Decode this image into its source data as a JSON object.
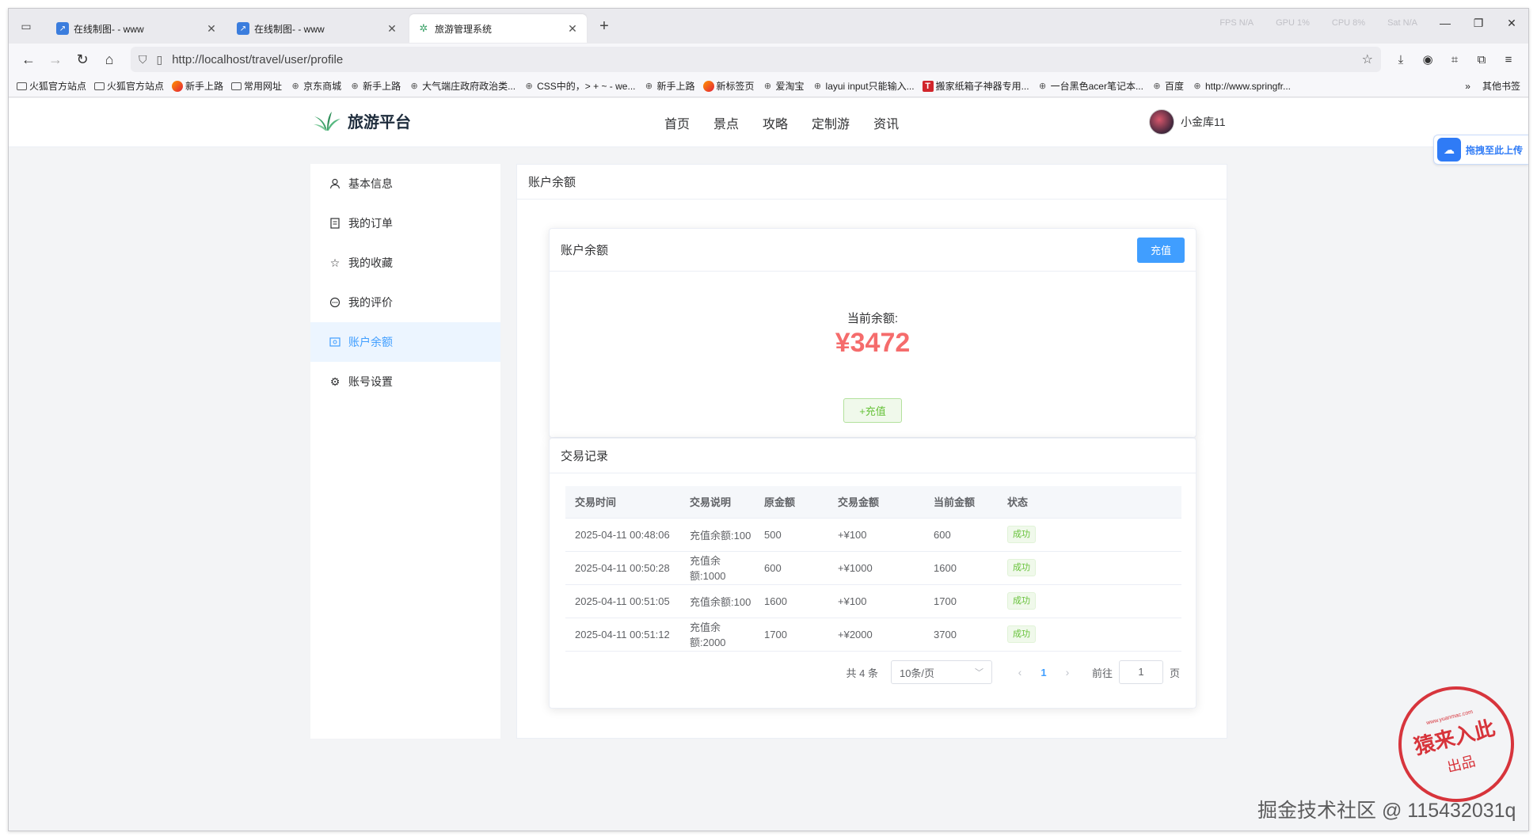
{
  "browser": {
    "tabs": [
      {
        "title": "在线制图- - www",
        "icon": "chart-favicon"
      },
      {
        "title": "在线制图- - www",
        "icon": "chart-favicon"
      },
      {
        "title": "旅游管理系统",
        "icon": "leaf-favicon"
      }
    ],
    "window_stats": [
      "FPS N/A",
      "GPU 1%",
      "CPU 8%",
      "Sat N/A"
    ],
    "url": "http://localhost/travel/user/profile",
    "bookmarks": [
      {
        "label": "火狐官方站点",
        "icon": "folder"
      },
      {
        "label": "火狐官方站点",
        "icon": "folder"
      },
      {
        "label": "新手上路",
        "icon": "firefox"
      },
      {
        "label": "常用网址",
        "icon": "folder"
      },
      {
        "label": "京东商城",
        "icon": "globe"
      },
      {
        "label": "新手上路",
        "icon": "globe"
      },
      {
        "label": "大气端庄政府政治类...",
        "icon": "globe"
      },
      {
        "label": "CSS中的，> + ~ - we...",
        "icon": "globe"
      },
      {
        "label": "新手上路",
        "icon": "globe"
      },
      {
        "label": "新标签页",
        "icon": "firefox"
      },
      {
        "label": "爱淘宝",
        "icon": "globe"
      },
      {
        "label": "layui input只能输入...",
        "icon": "globe"
      },
      {
        "label": "搬家纸箱子神器专用...",
        "icon": "red"
      },
      {
        "label": "一台黑色acer笔记本...",
        "icon": "globe"
      },
      {
        "label": "百度",
        "icon": "globe"
      },
      {
        "label": "http://www.springfr...",
        "icon": "globe"
      }
    ],
    "bookmarks_more": "其他书签"
  },
  "site": {
    "logo_text": "旅游平台",
    "nav": [
      "首页",
      "景点",
      "攻略",
      "定制游",
      "资讯"
    ],
    "username": "小金库11",
    "upload_float": "拖拽至此上传"
  },
  "sidebar": {
    "items": [
      {
        "label": "基本信息",
        "icon": "user-icon",
        "active": false
      },
      {
        "label": "我的订单",
        "icon": "document-icon",
        "active": false
      },
      {
        "label": "我的收藏",
        "icon": "star-icon",
        "active": false
      },
      {
        "label": "我的评价",
        "icon": "chat-icon",
        "active": false
      },
      {
        "label": "账户余额",
        "icon": "wallet-icon",
        "active": true
      },
      {
        "label": "账号设置",
        "icon": "gear-icon",
        "active": false
      }
    ]
  },
  "content": {
    "title": "账户余额",
    "balance_card": {
      "title": "账户余额",
      "recharge_button": "充值",
      "label": "当前余额:",
      "amount": "¥3472",
      "recharge_plain_button": "+充值"
    },
    "records": {
      "title": "交易记录",
      "columns": [
        "交易时间",
        "交易说明",
        "原金额",
        "交易金额",
        "当前金额",
        "状态"
      ],
      "rows": [
        [
          "2025-04-11 00:48:06",
          "充值余额:100",
          "500",
          "+¥100",
          "600",
          "成功"
        ],
        [
          "2025-04-11 00:50:28",
          "充值余额:1000",
          "600",
          "+¥1000",
          "1600",
          "成功"
        ],
        [
          "2025-04-11 00:51:05",
          "充值余额:100",
          "1600",
          "+¥100",
          "1700",
          "成功"
        ],
        [
          "2025-04-11 00:51:12",
          "充值余额:2000",
          "1700",
          "+¥2000",
          "3700",
          "成功"
        ]
      ]
    },
    "pagination": {
      "total": "共 4 条",
      "page_size": "10条/页",
      "current_page": "1",
      "goto_label": "前往",
      "goto_value": "1",
      "page_suffix": "页"
    }
  },
  "overlays": {
    "stamp_url": "www.yuanmac.com",
    "stamp_main": "猿来入此",
    "stamp_sub": "出品",
    "watermark": "掘金技术社区 @ 115432031q"
  }
}
